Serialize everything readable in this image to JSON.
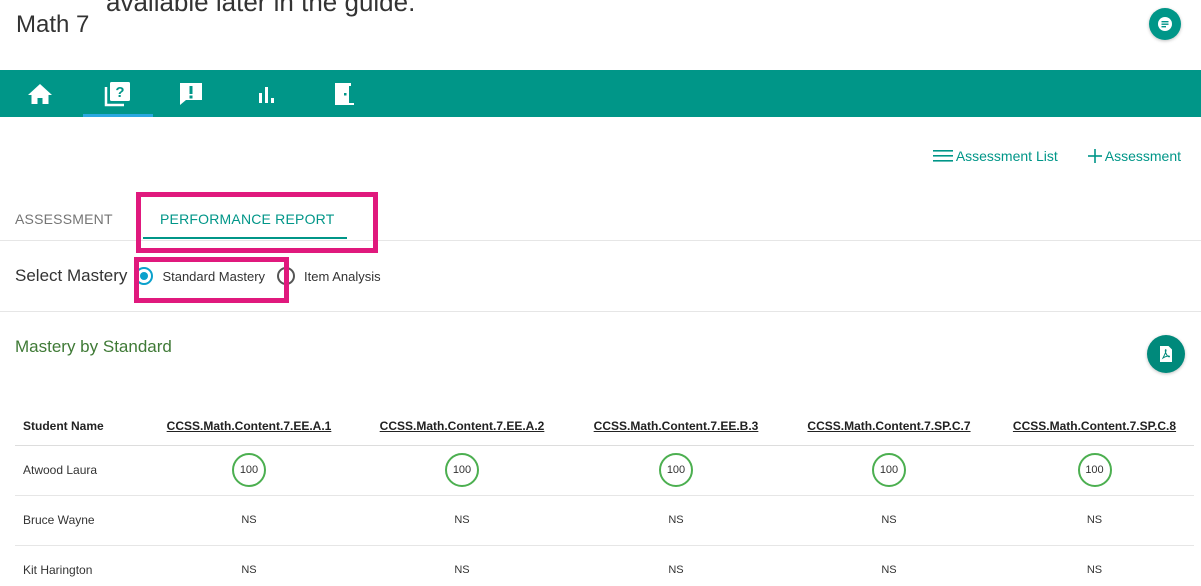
{
  "header": {
    "clipped_text": "available later in the guide.",
    "course_title": "Math 7"
  },
  "nav": {
    "items": [
      {
        "icon": "home-icon"
      },
      {
        "icon": "quiz-icon"
      },
      {
        "icon": "alert-icon"
      },
      {
        "icon": "bar-chart-icon"
      },
      {
        "icon": "exit-door-icon"
      }
    ],
    "active_index": 1
  },
  "actions": {
    "list_label": "Assessment List",
    "add_label": "Assessment"
  },
  "tabs": {
    "assessment": "ASSESSMENT",
    "report": "PERFORMANCE REPORT",
    "active": "PERFORMANCE REPORT"
  },
  "mastery": {
    "label": "Select Mastery",
    "options": [
      "Standard Mastery",
      "Item Analysis"
    ],
    "selected": "Standard Mastery"
  },
  "section": {
    "title": "Mastery by Standard"
  },
  "table": {
    "name_header": "Student Name",
    "standards": [
      "CCSS.Math.Content.7.EE.A.1",
      "CCSS.Math.Content.7.EE.A.2",
      "CCSS.Math.Content.7.EE.B.3",
      "CCSS.Math.Content.7.SP.C.7",
      "CCSS.Math.Content.7.SP.C.8"
    ],
    "rows": [
      {
        "name": "Atwood Laura",
        "scores": [
          "100",
          "100",
          "100",
          "100",
          "100"
        ]
      },
      {
        "name": "Bruce Wayne",
        "scores": [
          "NS",
          "NS",
          "NS",
          "NS",
          "NS"
        ]
      },
      {
        "name": "Kit Harington",
        "scores": [
          "NS",
          "NS",
          "NS",
          "NS",
          "NS"
        ]
      }
    ]
  },
  "colors": {
    "teal": "#009688",
    "highlight": "#e0197d",
    "mastery_green": "#4caf50",
    "radio_blue": "#0aa1cc"
  }
}
